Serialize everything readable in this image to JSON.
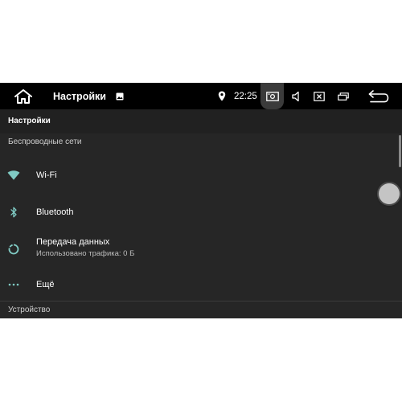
{
  "statusbar": {
    "title": "Настройки",
    "time": "22:25",
    "icons": [
      "home-icon",
      "image-notification-icon",
      "location-icon",
      "screenshot-icon",
      "volume-icon",
      "close-window-icon",
      "windows-icon",
      "back-icon"
    ]
  },
  "toolbar": {
    "title": "Настройки"
  },
  "sections": {
    "wireless": {
      "header": "Беспроводные сети",
      "items": [
        {
          "title": "Wi-Fi",
          "icon": "wifi-icon"
        },
        {
          "title": "Bluetooth",
          "icon": "bluetooth-icon"
        },
        {
          "title": "Передача данных",
          "subtitle": "Использовано трафика: 0 Б",
          "icon": "data-usage-icon"
        },
        {
          "title": "Ещё",
          "icon": "more-icon"
        }
      ]
    },
    "device": {
      "header": "Устройство"
    }
  },
  "colors": {
    "accent": "#80cbc4",
    "background": "#262626",
    "statusbar": "#000000"
  }
}
